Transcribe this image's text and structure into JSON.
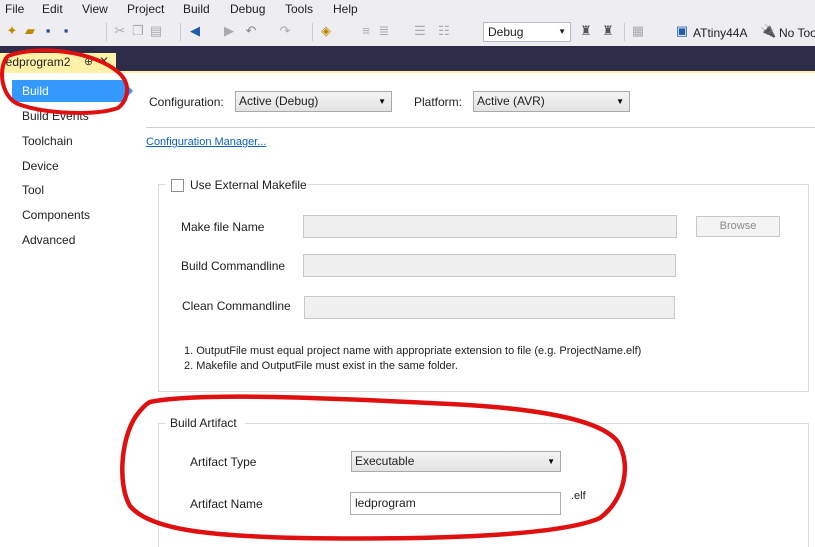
{
  "menu": [
    "File",
    "Edit",
    "View",
    "Project",
    "Build",
    "Debug",
    "Tools",
    "Help"
  ],
  "toolbar": {
    "config_value": "Debug",
    "device_label": "ATtiny44A",
    "tool_label": "No Too"
  },
  "tab": {
    "title": "ledprogram2",
    "pin_glyph": "⊕",
    "close_glyph": "✕"
  },
  "nav": {
    "items": [
      "Build",
      "Build Events",
      "Toolchain",
      "Device",
      "Tool",
      "Components",
      "Advanced"
    ],
    "selected": "Build"
  },
  "config": {
    "configuration_label": "Configuration:",
    "configuration_value": "Active (Debug)",
    "platform_label": "Platform:",
    "platform_value": "Active (AVR)",
    "manager_link": "Configuration Manager..."
  },
  "makefile": {
    "checkbox_label": "Use External Makefile",
    "checked": false,
    "make_file_name_label": "Make file Name",
    "make_file_name_value": "",
    "browse_label": "Browse",
    "build_cmd_label": "Build Commandline",
    "build_cmd_value": "",
    "clean_cmd_label": "Clean Commandline",
    "clean_cmd_value": "",
    "note1": "1. OutputFile must equal project name with appropriate extension to file (e.g. ProjectName.elf)",
    "note2": "2. Makefile and OutputFile must exist in the same folder."
  },
  "artifact": {
    "group_label": "Build Artifact",
    "type_label": "Artifact Type",
    "type_value": "Executable",
    "name_label": "Artifact Name",
    "name_value": "ledprogram",
    "extension": ".elf"
  },
  "annotation_color": "#e01010",
  "selection_color": "#3399ff",
  "tab_color": "#fff1a8"
}
